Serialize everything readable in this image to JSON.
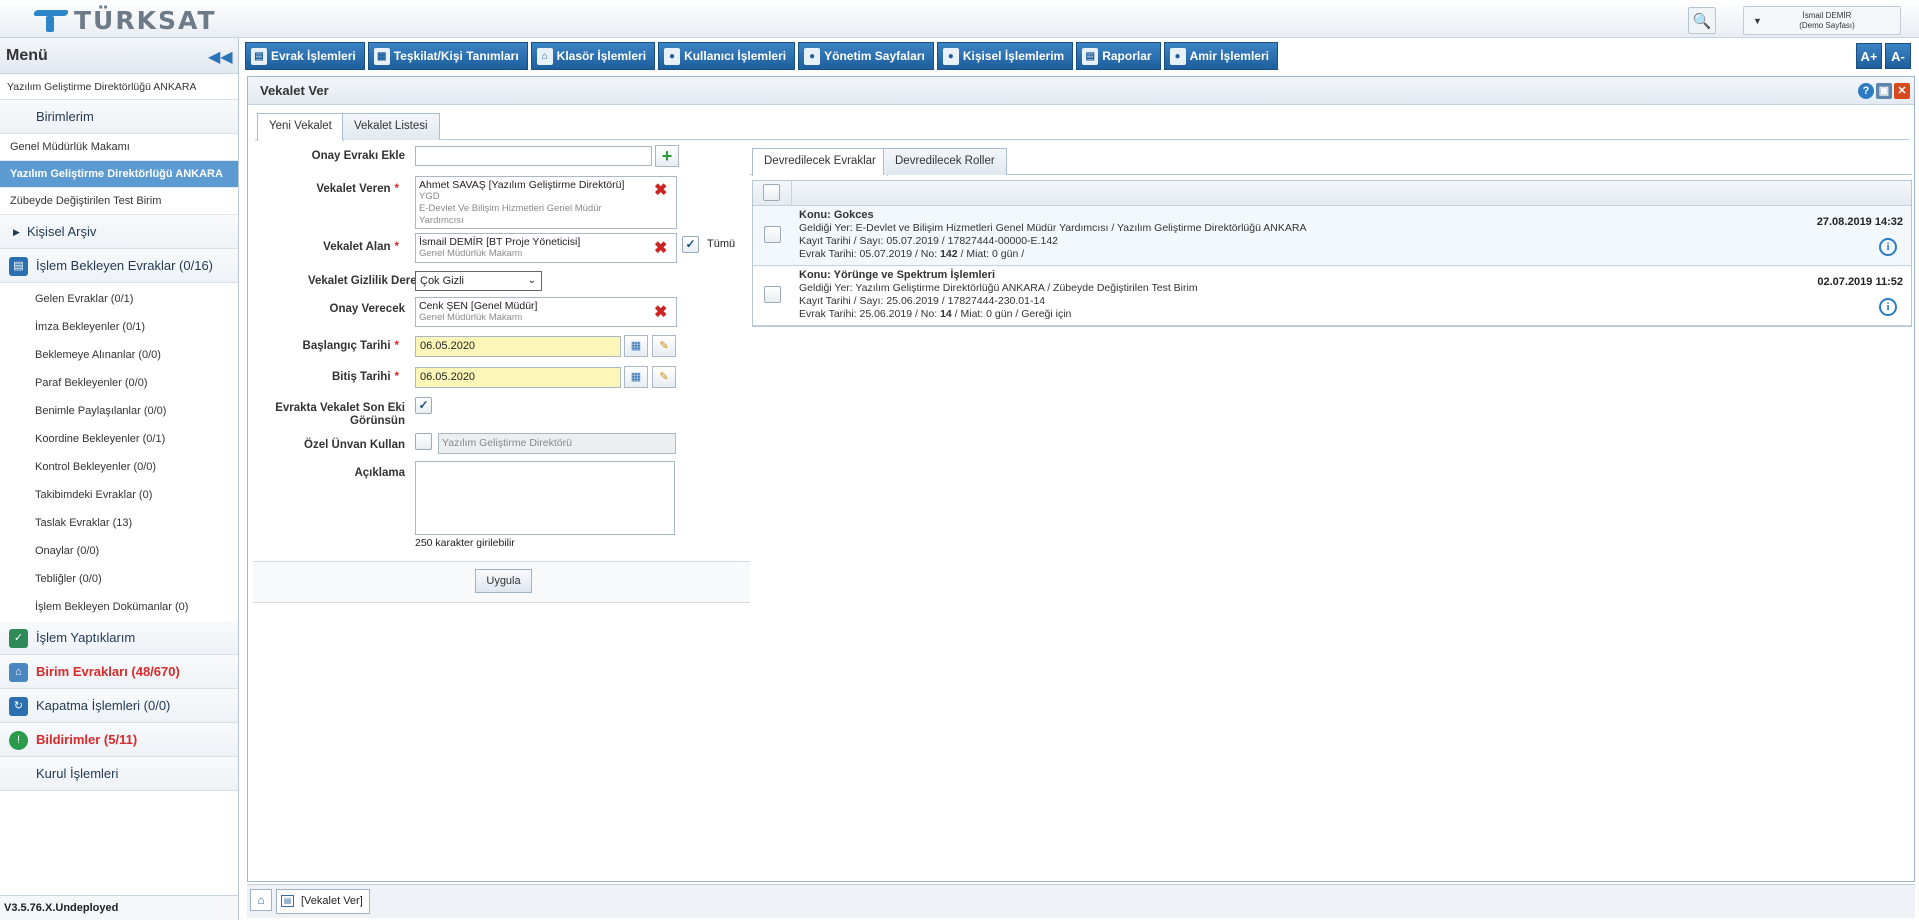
{
  "brand": {
    "logo_text": "TÜRKSAT"
  },
  "header": {
    "user_name": "İsmail DEMİR",
    "user_unit": "(Demo Sayfası)"
  },
  "sidebar": {
    "title": "Menü",
    "unit_line": "Yazılım Geliştirme Direktörlüğü ANKARA",
    "birimlerim": "Birimlerim",
    "units": [
      {
        "label": "Genel Müdürlük Makamı"
      },
      {
        "label": "Yazılım Geliştirme Direktörlüğü ANKARA"
      },
      {
        "label": "Zübeyde Değiştirilen Test Birim"
      }
    ],
    "kisisel_arsiv": "Kişisel Arşiv",
    "islem_bekleyen": "İşlem Bekleyen Evraklar (0/16)",
    "items": [
      {
        "label": "Gelen Evraklar (0/1)"
      },
      {
        "label": "İmza Bekleyenler (0/1)"
      },
      {
        "label": "Beklemeye Alınanlar (0/0)"
      },
      {
        "label": "Paraf Bekleyenler (0/0)"
      },
      {
        "label": "Benimle Paylaşılanlar (0/0)"
      },
      {
        "label": "Koordine Bekleyenler (0/1)"
      },
      {
        "label": "Kontrol Bekleyenler (0/0)"
      },
      {
        "label": "Takibimdeki Evraklar (0)"
      },
      {
        "label": "Taslak Evraklar (13)"
      },
      {
        "label": "Onaylar (0/0)"
      },
      {
        "label": "Tebliğler (0/0)"
      },
      {
        "label": "İşlem Bekleyen Dokümanlar (0)"
      }
    ],
    "islem_yaptiklarim": "İşlem Yaptıklarım",
    "birim_evraklari": "Birim Evrakları (48/670)",
    "kapatma": "Kapatma İşlemleri (0/0)",
    "bildirimler": "Bildirimler (5/11)",
    "kurul": "Kurul İşlemleri",
    "version": "V3.5.76.X.Undeployed"
  },
  "nav": {
    "items": [
      {
        "label": "Evrak İşlemleri"
      },
      {
        "label": "Teşkilat/Kişi Tanımları"
      },
      {
        "label": "Klasör İşlemleri"
      },
      {
        "label": "Kullanıcı İşlemleri"
      },
      {
        "label": "Yönetim Sayfaları"
      },
      {
        "label": "Kişisel İşlemlerim"
      },
      {
        "label": "Raporlar"
      },
      {
        "label": "Amir İşlemleri"
      }
    ],
    "font_plus": "A+",
    "font_minus": "A-"
  },
  "panel": {
    "title": "Vekalet Ver",
    "tabs": [
      {
        "label": "Yeni Vekalet"
      },
      {
        "label": "Vekalet Listesi"
      }
    ]
  },
  "form": {
    "onay_evraki_label": "Onay Evrakı Ekle",
    "vekalet_veren_label": "Vekalet Veren",
    "vekalet_veren": {
      "name": "Ahmet SAVAŞ [Yazılım Geliştirme Direktörü]",
      "line2": "YGD",
      "line3": "E-Devlet Ve Bilişim Hizmetleri Genel Müdür Yardımcısı"
    },
    "vekalet_alan_label": "Vekalet Alan",
    "vekalet_alan": {
      "name": "İsmail DEMİR [BT Proje Yöneticisi]",
      "line2": "Genel Müdürlük Makamı"
    },
    "tumu_label": "Tümü",
    "gizlilik_label": "Vekalet Gizlilik Derecesi",
    "gizlilik_value": "Çok Gizli",
    "onay_verecek_label": "Onay Verecek",
    "onay_verecek": {
      "name": "Cenk ŞEN [Genel Müdür]",
      "line2": "Genel Müdürlük Makamı"
    },
    "baslangic_label": "Başlangıç Tarihi",
    "baslangic_value": "06.05.2020",
    "bitis_label": "Bitiş Tarihi",
    "bitis_value": "06.05.2020",
    "son_eki_label_1": "Evrakta Vekalet Son Eki",
    "son_eki_label_2": "Görünsün",
    "ozel_unvan_label": "Özel Ünvan Kullan",
    "ozel_unvan_placeholder": "Yazılım Geliştirme Direktörü",
    "aciklama_label": "Açıklama",
    "char_hint": "250 karakter girilebilir",
    "submit": "Uygula"
  },
  "right": {
    "tabs": [
      {
        "label": "Devredilecek Evraklar"
      },
      {
        "label": "Devredilecek Roller"
      }
    ],
    "rows": [
      {
        "konu": "Konu: Gokces",
        "geldigi": "Geldiği Yer: E-Devlet ve Bilişim Hizmetleri Genel Müdür Yardımcısı / Yazılım Geliştirme Direktörlüğü ANKARA",
        "kayit": "Kayıt Tarihi / Sayı: 05.07.2019 / 17827444-00000-E.142",
        "evrak_prefix": "Evrak Tarihi: 05.07.2019 / No: ",
        "no": "142",
        "evrak_suffix": " / Miat: 0 gün /",
        "date": "27.08.2019 14:32"
      },
      {
        "konu": "Konu: Yörünge ve Spektrum İşlemleri",
        "geldigi": "Geldiği Yer: Yazılım Geliştirme Direktörlüğü ANKARA / Zübeyde Değiştirilen Test Birim",
        "kayit": "Kayıt Tarihi / Sayı: 25.06.2019 / 17827444-230.01-14",
        "evrak_prefix": "Evrak Tarihi: 25.06.2019 / No: ",
        "no": "14",
        "evrak_suffix": " / Miat: 0 gün / Gereği için",
        "date": "02.07.2019 11:52"
      }
    ]
  },
  "taskbar": {
    "item": "[Vekalet Ver]"
  }
}
